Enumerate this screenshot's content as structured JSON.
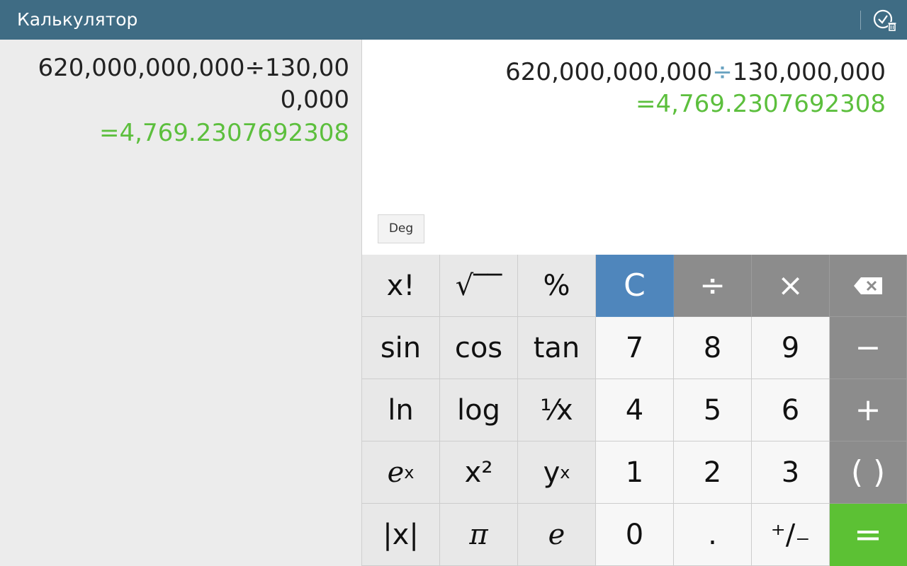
{
  "app": {
    "title": "Калькулятор"
  },
  "history": {
    "expression": "620,000,000,000÷130,000,000",
    "result": "=4,769.2307692308"
  },
  "display": {
    "expr_left": "620,000,000,000",
    "expr_op": "÷",
    "expr_right": "130,000,000",
    "result": "=4,769.2307692308",
    "angle_mode": "Deg"
  },
  "keys": {
    "factorial": "x!",
    "sqrt": "√‾‾",
    "percent": "%",
    "clear": "C",
    "divide": "÷",
    "multiply": "×",
    "sin": "sin",
    "cos": "cos",
    "tan": "tan",
    "n7": "7",
    "n8": "8",
    "n9": "9",
    "minus": "−",
    "ln": "ln",
    "log": "log",
    "reciprocal": "⅟x",
    "n4": "4",
    "n5": "5",
    "n6": "6",
    "plus": "+",
    "exp_base": "e",
    "exp_sup": "x",
    "square": "x²",
    "power_base": "y",
    "power_sup": "x",
    "n1": "1",
    "n2": "2",
    "n3": "3",
    "parens": "( )",
    "abs": "|x|",
    "pi": "π",
    "euler": "e",
    "n0": "0",
    "dot": ".",
    "sign": "⁺∕₋",
    "equals": "="
  },
  "colors": {
    "title_bar": "#3f6c84",
    "result_green": "#5cbf3d",
    "clear_blue": "#4f86bc",
    "operator_gray": "#8c8c8c",
    "equals_green": "#5cc134"
  },
  "icons": {
    "history": "history-clear-icon",
    "backspace": "backspace-icon"
  }
}
